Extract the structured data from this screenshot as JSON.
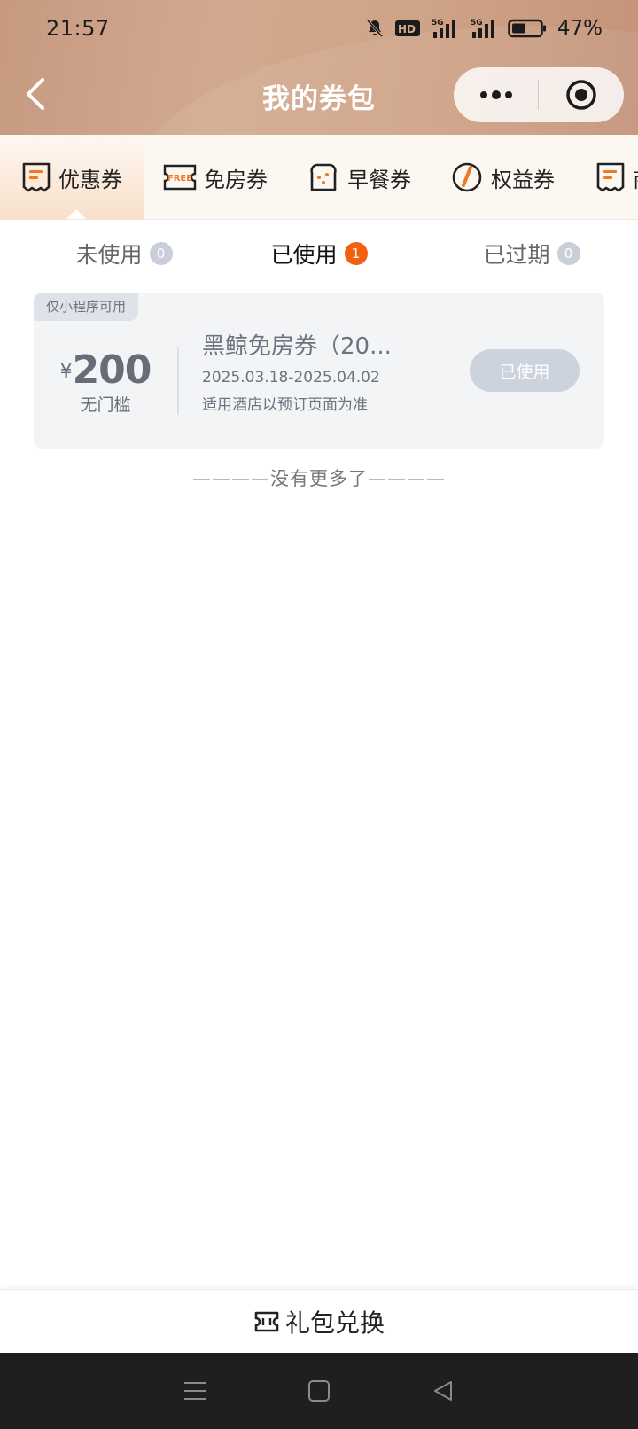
{
  "status_bar": {
    "time": "21:57",
    "hd_label": "HD",
    "signal_1": "5G",
    "signal_2": "5G",
    "battery_percent": "47%",
    "battery_level": 0.47
  },
  "nav": {
    "title": "我的券包"
  },
  "category_tabs": [
    {
      "label": "优惠券",
      "icon": "coupon-icon",
      "active": true
    },
    {
      "label": "免房券",
      "icon": "free-room-icon",
      "icon_text": "FREE",
      "active": false
    },
    {
      "label": "早餐券",
      "icon": "breakfast-icon",
      "active": false
    },
    {
      "label": "权益券",
      "icon": "benefit-icon",
      "active": false
    },
    {
      "label": "商",
      "icon": "coupon-icon",
      "active": false
    }
  ],
  "status_tabs": [
    {
      "label": "未使用",
      "count": "0",
      "active": false
    },
    {
      "label": "已使用",
      "count": "1",
      "active": true
    },
    {
      "label": "已过期",
      "count": "0",
      "active": false
    }
  ],
  "coupon": {
    "tag": "仅小程序可用",
    "currency": "¥",
    "amount": "200",
    "threshold": "无门槛",
    "title": "黑鲸免房券（20...",
    "dates": "2025.03.18-2025.04.02",
    "description": "适用酒店以预订页面为准",
    "button_label": "已使用"
  },
  "no_more_text": "————没有更多了————",
  "bottom_bar": {
    "exchange_label": "礼包兑换"
  },
  "colors": {
    "accent": "#f2610f",
    "header_bg": "#cfa386",
    "icon_orange": "#f07a22"
  }
}
